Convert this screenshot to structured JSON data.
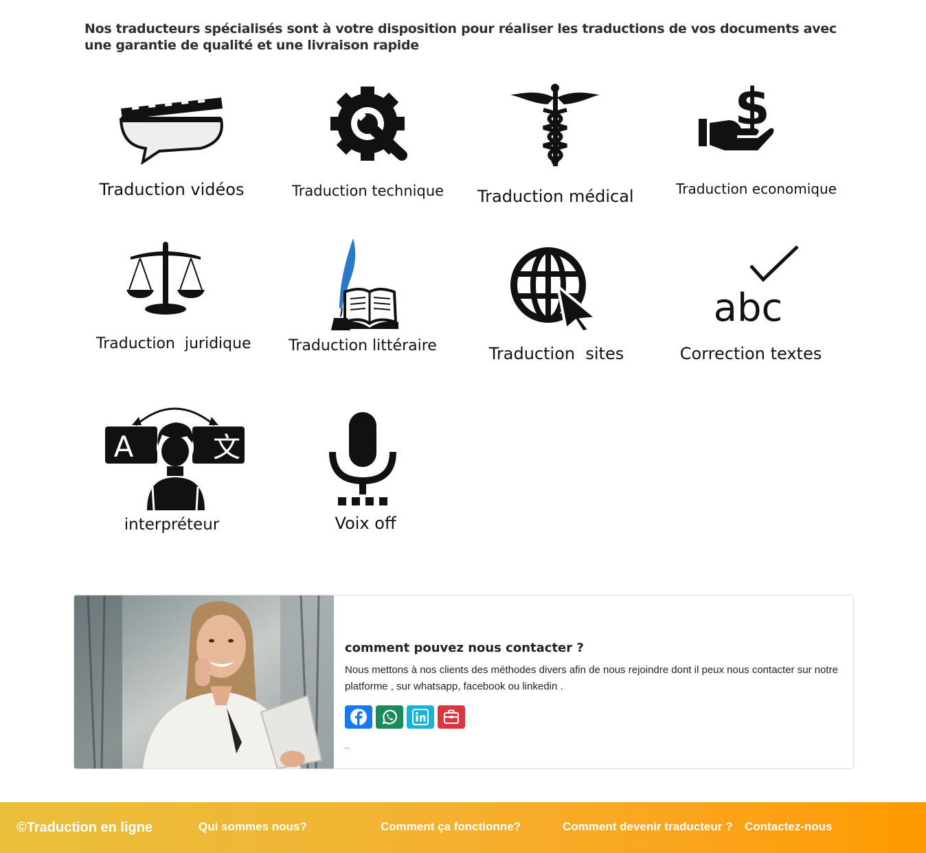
{
  "intro": "Nos traducteurs spécialisés sont à votre disposition pour réaliser les traductions de vos documents avec une garantie de qualité et une livraison rapide",
  "services": [
    {
      "label": "Traduction vidéos",
      "icon": "video-clapper-speech-icon"
    },
    {
      "label": "Traduction technique",
      "icon": "gear-wrench-icon"
    },
    {
      "label": "Traduction médical",
      "icon": "caduceus-icon"
    },
    {
      "label": "Traduction economique",
      "icon": "hand-dollar-icon"
    },
    {
      "label": "Traduction  juridique",
      "icon": "scales-icon"
    },
    {
      "label": "Traduction littéraire",
      "icon": "quill-book-icon"
    },
    {
      "label": "Traduction  sites",
      "icon": "globe-cursor-icon"
    },
    {
      "label": "Correction textes",
      "icon": "abc-check-icon"
    },
    {
      "label": "interpréteur",
      "icon": "interpreter-icon"
    },
    {
      "label": "Voix off",
      "icon": "microphone-icon"
    }
  ],
  "contact": {
    "title": "comment pouvez nous contacter ?",
    "text": "Nous mettons à nos clients des méthodes divers afin de nous rejoindre dont il peux nous contacter sur notre platforme , sur whatsapp, facebook ou linkedin .",
    "dots": "..",
    "socials": [
      {
        "icon": "facebook-icon",
        "color": "#1877f2"
      },
      {
        "icon": "whatsapp-icon",
        "color": "#1a8a5a"
      },
      {
        "icon": "linkedin-icon",
        "color": "#17b4d8"
      },
      {
        "icon": "toolbox-icon",
        "color": "#d9363e"
      }
    ]
  },
  "footer": {
    "copyright": "©Traduction en ligne",
    "links": [
      "Qui sommes nous?",
      "Comment ça fonctionne?",
      "Comment devenir traducteur ?",
      "Contactez-nous"
    ]
  }
}
